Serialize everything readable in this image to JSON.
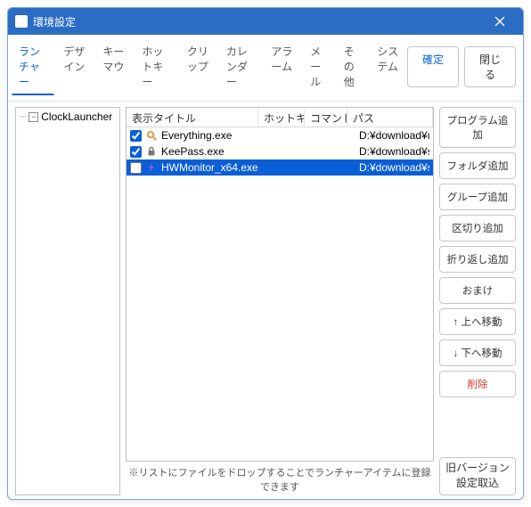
{
  "window": {
    "title": "環境設定"
  },
  "tabs": {
    "items": [
      "ランチャー",
      "デザイン",
      "キーマウ",
      "ホットキー",
      "クリップ",
      "カレンダー",
      "アラーム",
      "メール",
      "その他",
      "システム"
    ],
    "active_index": 0
  },
  "buttons": {
    "ok": "確定",
    "close": "閉じる"
  },
  "tree": {
    "root": "ClockLauncher",
    "expand_glyph": "−"
  },
  "columns": {
    "title": "表示タイトル",
    "hotkey": "ホットキー",
    "command": "コマンド",
    "path": "パス"
  },
  "rows": [
    {
      "checked": true,
      "selected": false,
      "icon": "search-icon",
      "title": "Everything.exe",
      "path": "D:¥download¥utility¥"
    },
    {
      "checked": true,
      "selected": false,
      "icon": "lock-icon",
      "title": "KeePass.exe",
      "path": "D:¥download¥securit"
    },
    {
      "checked": false,
      "selected": true,
      "icon": "bolt-icon",
      "title": "HWMonitor_x64.exe",
      "path": "D:¥download¥system"
    }
  ],
  "side": {
    "add_program": "プログラム追加",
    "add_folder": "フォルダ追加",
    "add_group": "グループ追加",
    "add_separator": "区切り追加",
    "add_wrap": "折り返し追加",
    "extra": "おまけ",
    "move_up": "↑ 上へ移動",
    "move_down": "↓ 下へ移動",
    "delete": "削除",
    "legacy_line1": "旧バージョン",
    "legacy_line2": "設定取込"
  },
  "hint": "※リストにファイルをドロップすることでランチャーアイテムに登録できます"
}
